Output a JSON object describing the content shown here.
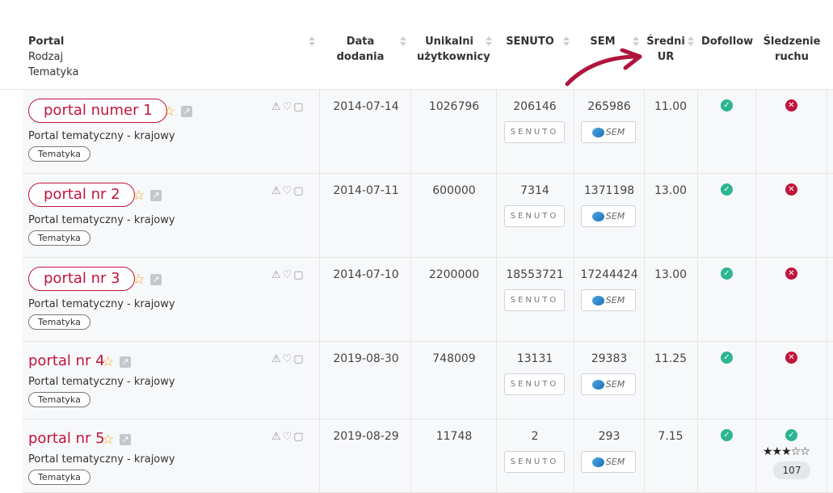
{
  "header": {
    "portal": "Portal",
    "rodzaj": "Rodzaj",
    "tematyka": "Tematyka",
    "data_dodania": "Data dodania",
    "unikalni_1": "Unikalni",
    "unikalni_2": "użytkownicy",
    "senuto": "SENUTO",
    "sem": "SEM",
    "sredni_1": "Średni",
    "sredni_2": "UR",
    "dofollow": "Dofollow",
    "sledzenie_1": "Śledzenie",
    "sledzenie_2": "ruchu"
  },
  "badges": {
    "senuto": "SENUTO",
    "sem": "SEM"
  },
  "colors": {
    "accent": "#c0143c",
    "ok": "#2bb592",
    "star": "#f0a500"
  },
  "rows": [
    {
      "name": "portal numer 1",
      "type": "Portal tematyczny - krajowy",
      "tag": "Tematyka",
      "date": "2014-07-14",
      "users": "1026796",
      "senuto": "206146",
      "sem": "265986",
      "ur": "11.00"
    },
    {
      "name": "portal nr 2",
      "type": "Portal tematyczny - krajowy",
      "tag": "Tematyka",
      "date": "2014-07-11",
      "users": "600000",
      "senuto": "7314",
      "sem": "1371198",
      "ur": "13.00"
    },
    {
      "name": "portal nr 3",
      "type": "Portal tematyczny - krajowy",
      "tag": "Tematyka",
      "date": "2014-07-10",
      "users": "2200000",
      "senuto": "18553721",
      "sem": "17244424",
      "ur": "13.00"
    },
    {
      "name": "portal nr 4",
      "type": "Portal tematyczny - krajowy",
      "tag": "Tematyka",
      "date": "2019-08-30",
      "users": "748009",
      "senuto": "13131",
      "sem": "29383",
      "ur": "11.25"
    },
    {
      "name": "portal nr 5",
      "type": "Portal tematyczny - krajowy",
      "tag": "Tematyka",
      "date": "2019-08-29",
      "users": "11748",
      "senuto": "2",
      "sem": "293",
      "ur": "7.15",
      "rating": 3,
      "rating_count": "107"
    }
  ]
}
